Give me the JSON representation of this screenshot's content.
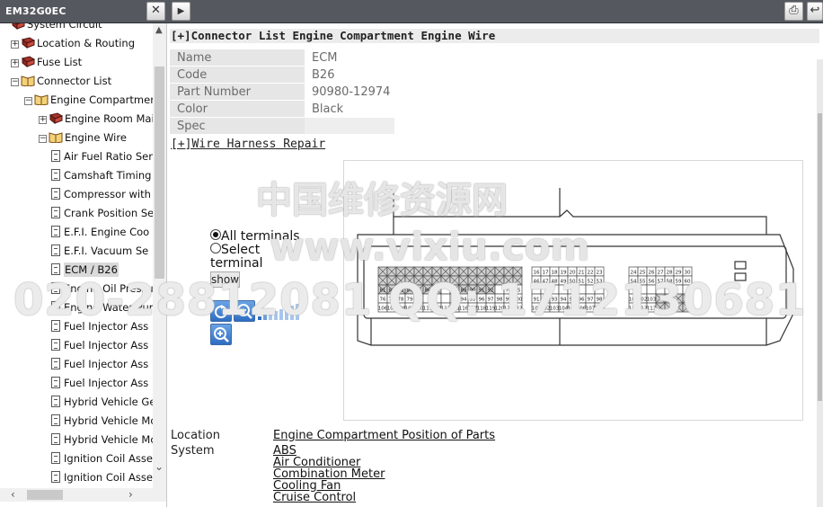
{
  "toolbar": {
    "title": "EM32G0EC",
    "close_glyph": "✕",
    "play_glyph": "▶",
    "print_glyph": "⎙",
    "back_glyph": "↩"
  },
  "tree": {
    "items": [
      {
        "label": "System Circuit",
        "expander": "",
        "icon": "book-icon",
        "level": 1
      },
      {
        "label": "Location & Routing",
        "expander": "+",
        "icon": "book-icon",
        "level": 1
      },
      {
        "label": "Fuse List",
        "expander": "+",
        "icon": "book-icon",
        "level": 1
      },
      {
        "label": "Connector List",
        "expander": "−",
        "icon": "open-book-icon",
        "level": 1
      },
      {
        "label": "Engine Compartmer",
        "expander": "−",
        "icon": "open-book-icon",
        "level": 2
      },
      {
        "label": "Engine Room Mai",
        "expander": "+",
        "icon": "book-icon",
        "level": 3
      },
      {
        "label": "Engine Wire",
        "expander": "−",
        "icon": "open-book-icon",
        "level": 3
      },
      {
        "label": "Air Fuel Ratio Ser",
        "expander": "",
        "icon": "document-icon",
        "level": 4
      },
      {
        "label": "Camshaft Timing",
        "expander": "",
        "icon": "document-icon",
        "level": 4
      },
      {
        "label": "Compressor with",
        "expander": "",
        "icon": "document-icon",
        "level": 4
      },
      {
        "label": "Crank Position Se",
        "expander": "",
        "icon": "document-icon",
        "level": 4
      },
      {
        "label": "E.F.I. Engine Coo",
        "expander": "",
        "icon": "document-icon",
        "level": 4
      },
      {
        "label": "E.F.I. Vacuum Se",
        "expander": "",
        "icon": "document-icon",
        "level": 4
      },
      {
        "label": "ECM / B26",
        "expander": "",
        "icon": "document-icon",
        "level": 4,
        "selected": true
      },
      {
        "label": "Engine Oil Pressu",
        "expander": "",
        "icon": "document-icon",
        "level": 4
      },
      {
        "label": "Engine Water Pur",
        "expander": "",
        "icon": "document-icon",
        "level": 4
      },
      {
        "label": "Fuel Injector Ass",
        "expander": "",
        "icon": "document-icon",
        "level": 4
      },
      {
        "label": "Fuel Injector Ass",
        "expander": "",
        "icon": "document-icon",
        "level": 4
      },
      {
        "label": "Fuel Injector Ass",
        "expander": "",
        "icon": "document-icon",
        "level": 4
      },
      {
        "label": "Fuel Injector Ass",
        "expander": "",
        "icon": "document-icon",
        "level": 4
      },
      {
        "label": "Hybrid Vehicle Ge",
        "expander": "",
        "icon": "document-icon",
        "level": 4
      },
      {
        "label": "Hybrid Vehicle Mo",
        "expander": "",
        "icon": "document-icon",
        "level": 4
      },
      {
        "label": "Hybrid Vehicle Mo",
        "expander": "",
        "icon": "document-icon",
        "level": 4
      },
      {
        "label": "Ignition Coil Asse",
        "expander": "",
        "icon": "document-icon",
        "level": 4
      },
      {
        "label": "Ignition Coil Asse",
        "expander": "",
        "icon": "document-icon",
        "level": 4
      }
    ]
  },
  "main": {
    "heading": "[+]Connector List  Engine Compartment  Engine Wire",
    "properties": [
      {
        "key": "Name",
        "value": "ECM"
      },
      {
        "key": "Code",
        "value": "B26"
      },
      {
        "key": "Part Number",
        "value": "90980-12974"
      },
      {
        "key": "Color",
        "value": "Black"
      },
      {
        "key": "Spec",
        "value": ""
      }
    ],
    "wire_harness_link": "[+]Wire Harness Repair",
    "controls": {
      "all_terminals": "All terminals",
      "select_terminal": "Select terminal",
      "show": "show",
      "selected_option": "All terminals"
    },
    "location_label": "Location",
    "location_value": "Engine Compartment  Position of Parts",
    "system_label": "System",
    "systems": [
      "ABS",
      "Air Conditioner",
      "Combination Meter",
      "Cooling Fan",
      "Cruise Control"
    ]
  },
  "connector": {
    "block1": {
      "row1": [
        "",
        "",
        "",
        "",
        "",
        "",
        "",
        ""
      ],
      "row2": [
        "",
        "",
        "",
        "",
        "",
        "",
        "",
        ""
      ],
      "row3": [
        "81",
        "82",
        "83",
        "84",
        "85",
        "86",
        "87",
        ""
      ],
      "row4": [
        "76",
        "77",
        "78",
        "79",
        "80",
        "",
        "",
        ""
      ],
      "row5": [
        "106",
        "107",
        "108",
        "109",
        "110",
        "111",
        "112",
        "113",
        "114"
      ]
    },
    "block2": {
      "row3": [
        "88",
        "89",
        "90",
        "91",
        "92",
        "",
        "74",
        "75"
      ],
      "row4": [
        "93",
        "94",
        "95",
        "96",
        "97",
        "98",
        "99",
        "100"
      ],
      "row5": [
        "115",
        "116",
        "117",
        "118",
        "119",
        "120",
        "121",
        "122"
      ]
    },
    "block3": {
      "row1": [
        "16",
        "17",
        "18",
        "19",
        "20",
        "21",
        "22",
        "23"
      ],
      "row2": [
        "46",
        "47",
        "48",
        "49",
        "50",
        "51",
        "52",
        "53"
      ],
      "row3": [
        "",
        "",
        "",
        "",
        "",
        "",
        "",
        ""
      ],
      "row4": [
        "91",
        "92",
        "93",
        "94",
        "95",
        "96",
        "97",
        "98"
      ],
      "row5": [
        "101",
        "102",
        "103",
        "104",
        "105",
        "106",
        "107",
        "108"
      ]
    },
    "block4": {
      "row1": [
        "24",
        "25",
        "26",
        "27",
        "28",
        "29",
        "30"
      ],
      "row2": [
        "54",
        "55",
        "56",
        "57",
        "58",
        "59",
        "60"
      ],
      "row4": [
        "101",
        "102",
        "103",
        "",
        "",
        "",
        ""
      ],
      "row5": [
        "111",
        "112",
        "113",
        "",
        "",
        "",
        ""
      ]
    }
  },
  "watermark": {
    "line1": "中国维修资源网",
    "line2": "www.vixiu.com",
    "line3": "020-28812081   QQ:  1712130681"
  }
}
